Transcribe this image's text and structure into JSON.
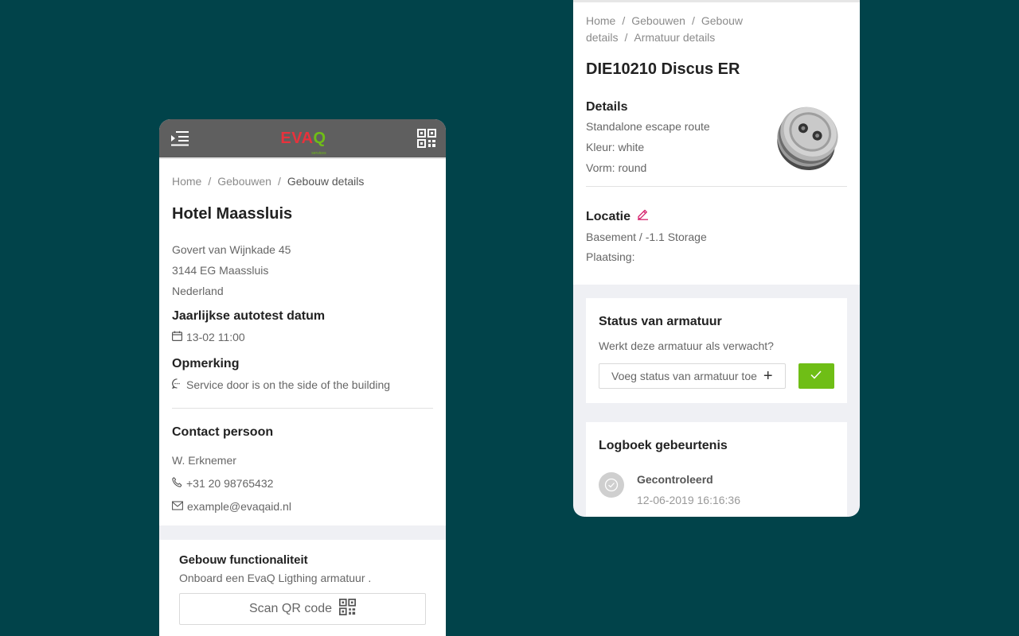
{
  "left": {
    "logo": {
      "text_main": "EVA",
      "text_accent": "Q",
      "sub": "services"
    },
    "breadcrumb": [
      "Home",
      "Gebouwen",
      "Gebouw details"
    ],
    "breadcrumb_sep": "/",
    "title": "Hotel Maassluis",
    "address": [
      "Govert van Wijnkade 45",
      "3144 EG Maassluis",
      "Nederland"
    ],
    "autotest": {
      "heading": "Jaarlijkse autotest datum",
      "value": "13-02 11:00"
    },
    "remark": {
      "heading": "Opmerking",
      "value": "Service door is on the side of the building"
    },
    "contact": {
      "heading": "Contact persoon",
      "name": "W. Erknemer",
      "phone": "+31 20 98765432",
      "email": "example@evaqaid.nl"
    },
    "functionality": {
      "heading": "Gebouw functionaliteit",
      "text": "Onboard een EvaQ Ligthing armatuur .",
      "button": "Scan QR code"
    }
  },
  "right": {
    "breadcrumb": [
      "Home",
      "Gebouwen",
      "Gebouw details",
      "Armatuur details"
    ],
    "breadcrumb_sep": "/",
    "title": "DIE10210 Discus ER",
    "details": {
      "heading": "Details",
      "lines": [
        "Standalone escape route",
        "Kleur: white",
        "Vorm: round"
      ]
    },
    "location": {
      "heading": "Locatie",
      "lines": [
        "Basement / -1.1 Storage",
        "Plaatsing:"
      ]
    },
    "status": {
      "heading": "Status van armatuur",
      "question": "Werkt deze armatuur als verwacht?",
      "input_label": "Voeg status van armatuur toe",
      "plus": "+"
    },
    "log": {
      "heading": "Logboek gebeurtenis",
      "entries": [
        {
          "title": "Gecontroleerd",
          "date": "12-06-2019 16:16:36"
        }
      ]
    }
  },
  "colors": {
    "background": "#01434a",
    "appbar": "#5f5f5f",
    "accent_green": "#6fbe16",
    "accent_red": "#e8323c",
    "edit_pink": "#d6246e"
  }
}
